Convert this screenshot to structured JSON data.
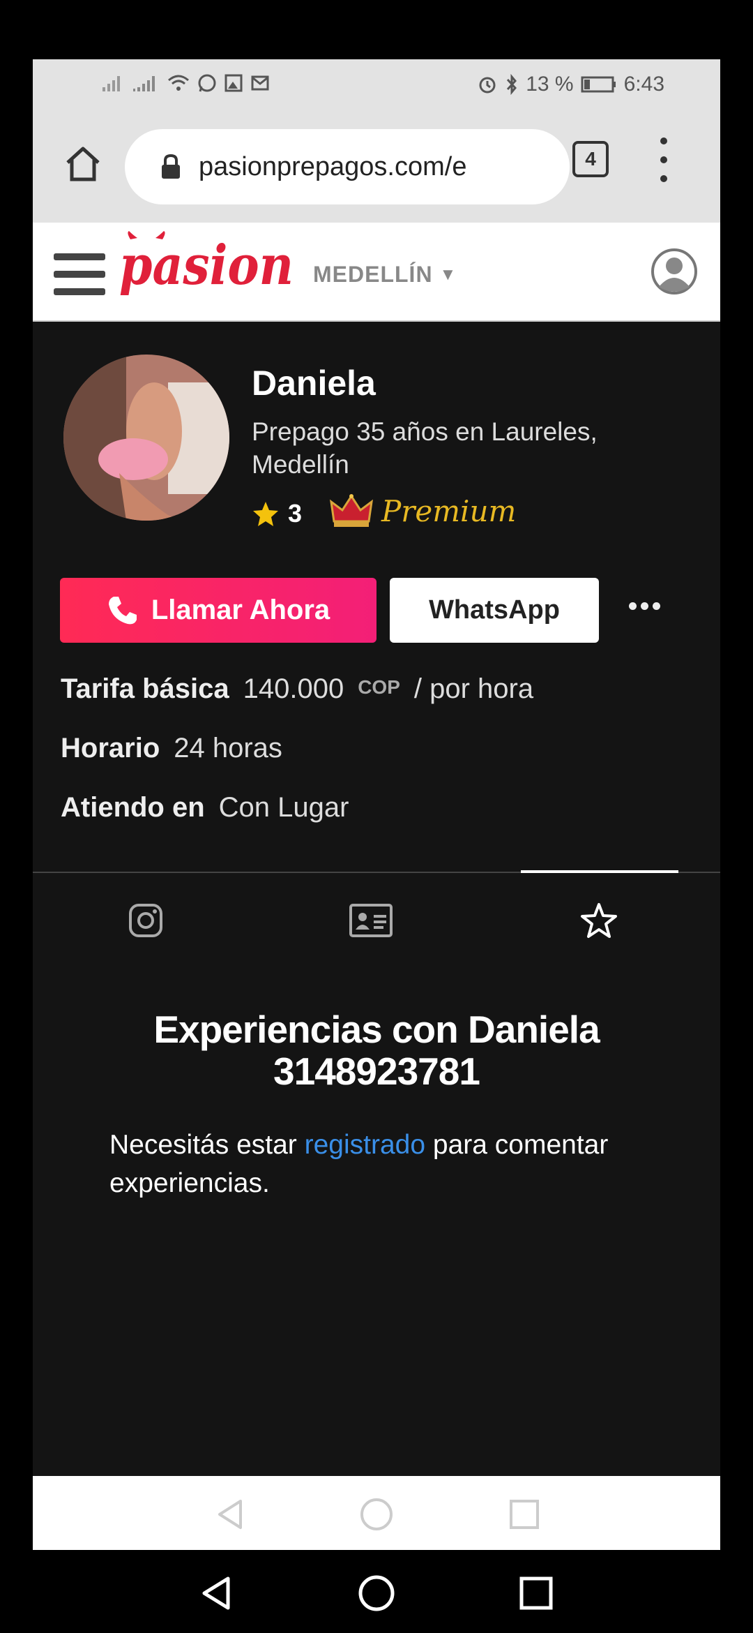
{
  "status_bar": {
    "battery": "13 %",
    "time": "6:43"
  },
  "browser": {
    "url": "pasionprepagos.com/e",
    "tab_count": "4"
  },
  "site": {
    "brand": "pasion",
    "city": "MEDELLÍN",
    "brand_color": "#e0203a"
  },
  "profile": {
    "name": "Daniela",
    "subtitle": "Prepago 35 años en Laureles, Medellín",
    "rating": "3",
    "badge": "Premium",
    "call_label": "Llamar Ahora",
    "whatsapp_label": "WhatsApp",
    "accent": "#ff2a55"
  },
  "info": {
    "rate_key": "Tarifa básica",
    "rate_value": "140.000",
    "rate_currency": "COP",
    "rate_unit": "/ por hora",
    "hours_key": "Horario",
    "hours_value": "24 horas",
    "place_key": "Atiendo en",
    "place_value": "Con Lugar"
  },
  "tabs": {
    "icons": [
      "instagram-icon",
      "id-card-icon",
      "star-icon"
    ],
    "active": "star-icon"
  },
  "experiences": {
    "title_line1": "Experiencias con Daniela",
    "title_line2": "3148923781",
    "text_before": "Necesitás estar ",
    "link": "registrado",
    "text_after": " para comentar experiencias."
  }
}
